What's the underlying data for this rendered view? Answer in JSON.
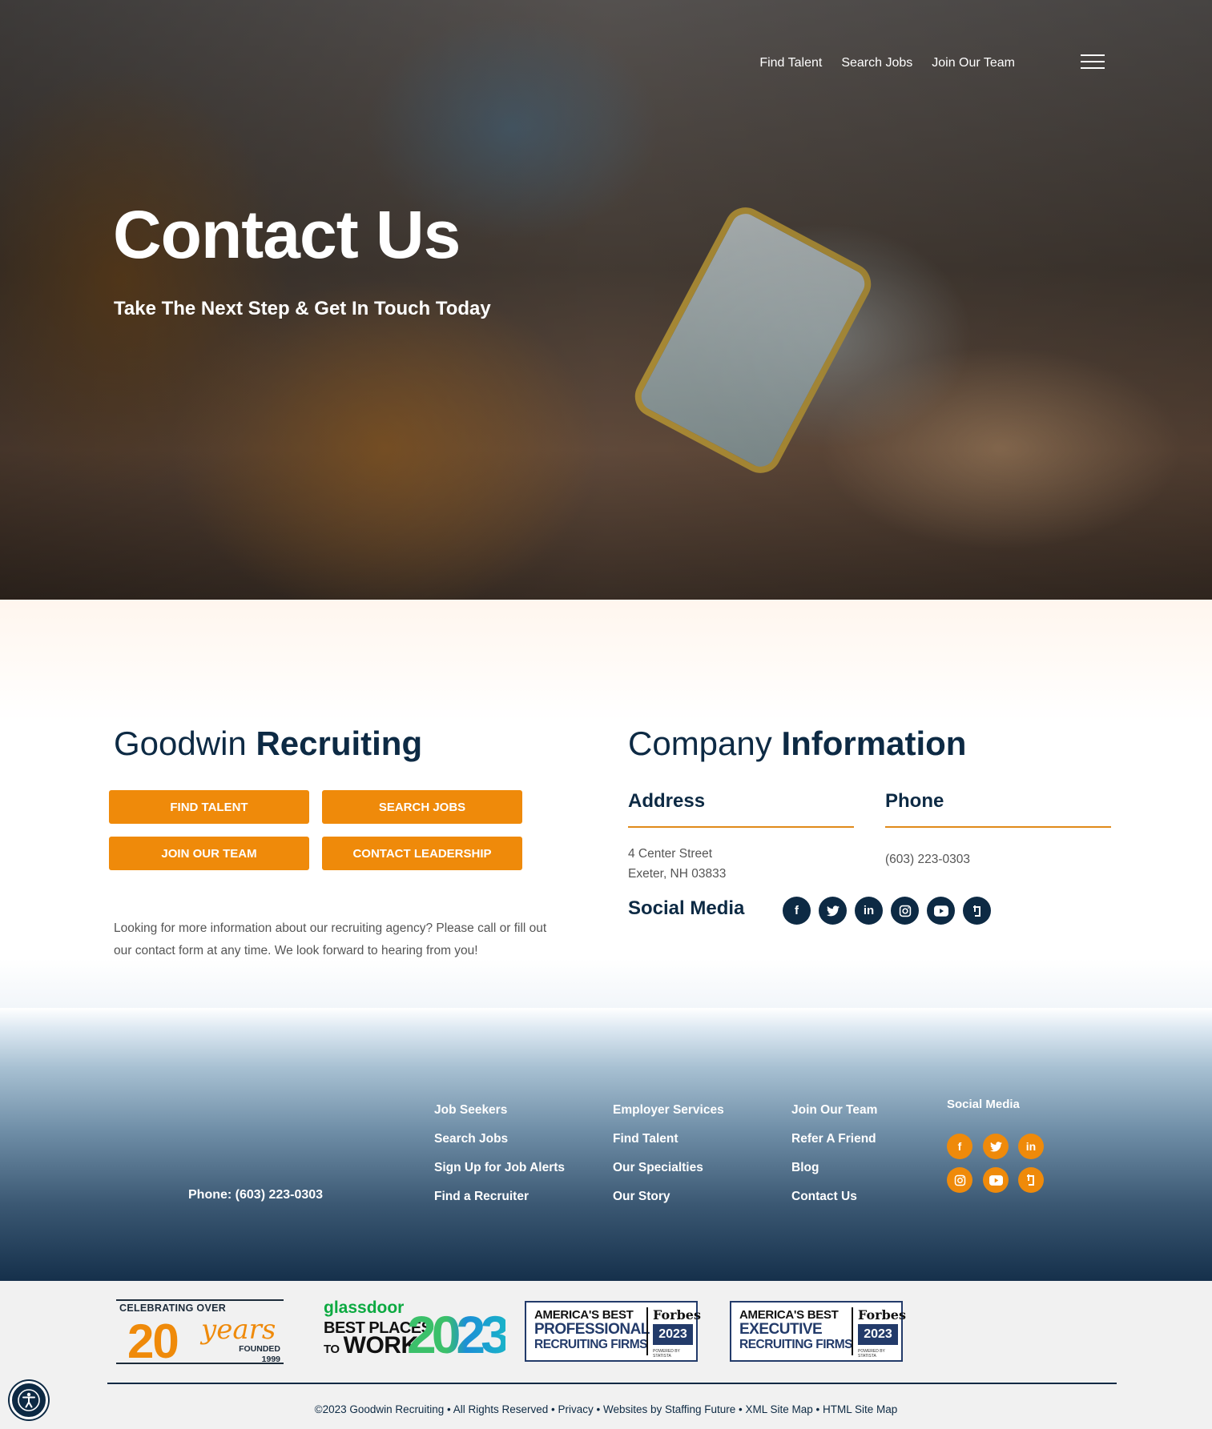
{
  "nav": {
    "links": [
      "Find Talent",
      "Search Jobs",
      "Join Our Team"
    ],
    "menu_icon": "hamburger-icon"
  },
  "hero": {
    "title": "Contact Us",
    "subtitle": "Take The Next Step & Get In Touch Today"
  },
  "left": {
    "title_light": "Goodwin",
    "title_bold": "Recruiting",
    "buttons": [
      "FIND TALENT",
      "SEARCH JOBS",
      "JOIN OUR TEAM",
      "CONTACT LEADERSHIP"
    ],
    "about": "Looking for more information about our recruiting agency? Please call or fill out our contact form at any time. We look forward to hearing from you!"
  },
  "right": {
    "title_light": "Company",
    "title_bold": "Information",
    "address_label": "Address",
    "address_line1": "4 Center Street",
    "address_line2": "Exeter, NH 03833",
    "phone_label": "Phone",
    "phone": "(603) 223-0303",
    "social_label": "Social Media",
    "social_icons": [
      "facebook-icon",
      "twitter-icon",
      "linkedin-icon",
      "instagram-icon",
      "youtube-icon",
      "glassdoor-icon"
    ]
  },
  "footer": {
    "phone": "Phone: (603) 223-0303",
    "col1": [
      "Job Seekers",
      "Search Jobs",
      "Sign Up for Job Alerts",
      "Find a Recruiter"
    ],
    "col2": [
      "Employer Services",
      "Find Talent",
      "Our Specialties",
      "Our Story"
    ],
    "col3": [
      "Join Our Team",
      "Refer A Friend",
      "Blog",
      "Contact Us"
    ],
    "social_title": "Social Media"
  },
  "badges": {
    "celebrate": {
      "top": "CELEBRATING OVER",
      "num": "20",
      "word": "years",
      "founded": "FOUNDED",
      "year": "1999"
    },
    "glassdoor": {
      "brand": "glassdoor",
      "line1": "BEST PLACES",
      "line2_a": "TO",
      "line2_b": "WORK",
      "year": "2023"
    },
    "forbes1": {
      "l1": "AMERICA'S BEST",
      "l2": "PROFESSIONAL",
      "l3": "RECRUITING FIRMS",
      "brand": "Forbes",
      "year": "2023",
      "powered": "POWERED BY STATISTA"
    },
    "forbes2": {
      "l1": "AMERICA'S BEST",
      "l2": "EXECUTIVE",
      "l3": "RECRUITING FIRMS",
      "brand": "Forbes",
      "year": "2023",
      "powered": "POWERED BY STATISTA"
    }
  },
  "copyright": "©2023 Goodwin Recruiting • All Rights Reserved • Privacy • Websites by Staffing Future • XML Site Map • HTML Site Map",
  "colors": {
    "accent": "#ef8a0a",
    "navy": "#0d2a44"
  }
}
